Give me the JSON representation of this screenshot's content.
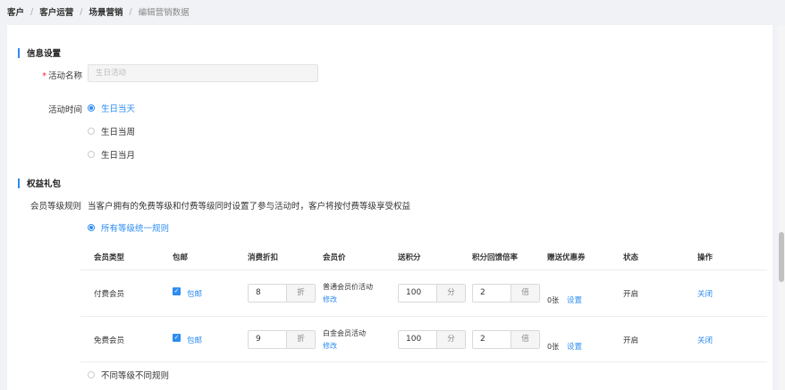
{
  "breadcrumb": [
    "客户",
    "客户运营",
    "场景营销",
    "编辑营销数据"
  ],
  "info_section": {
    "title": "信息设置",
    "name_label": "活动名称",
    "name_placeholder": "生日活动",
    "time_label": "活动时间",
    "time_options": [
      {
        "label": "生日当天",
        "checked": true
      },
      {
        "label": "生日当周",
        "checked": false
      },
      {
        "label": "生日当月",
        "checked": false
      }
    ]
  },
  "gift_section": {
    "title": "权益礼包",
    "rule_label": "会员等级规则",
    "rule_desc": "当客户拥有的免费等级和付费等级同时设置了参与活动时，客户将按付费等级享受权益",
    "option_all": {
      "label": "所有等级统一规则",
      "checked": true
    },
    "option_diff": {
      "label": "不同等级不同规则",
      "checked": false
    },
    "table": {
      "headers": [
        "会员类型",
        "包邮",
        "消费折扣",
        "会员价",
        "送积分",
        "积分回馈倍率",
        "赠送优惠券",
        "状态",
        "操作"
      ],
      "rows": [
        {
          "type": "付费会员",
          "free_shipping": "包邮",
          "discount": "8",
          "discount_unit": "折",
          "member_price_text": "普通会员价活动",
          "member_price_link": "修改",
          "points": "100",
          "points_unit": "分",
          "multiplier": "2",
          "multiplier_unit": "倍",
          "coupon_count": "0张",
          "coupon_link": "设置",
          "status": "开启",
          "action": "关闭"
        },
        {
          "type": "免费会员",
          "free_shipping": "包邮",
          "discount": "9",
          "discount_unit": "折",
          "member_price_text": "白金会员活动",
          "member_price_link": "修改",
          "points": "100",
          "points_unit": "分",
          "multiplier": "2",
          "multiplier_unit": "倍",
          "coupon_count": "0张",
          "coupon_link": "设置",
          "status": "开启",
          "action": "关闭"
        }
      ]
    }
  },
  "colors": {
    "accent": "#2d8cf0",
    "required": "#f5222d",
    "background": "#f0f2f5"
  }
}
